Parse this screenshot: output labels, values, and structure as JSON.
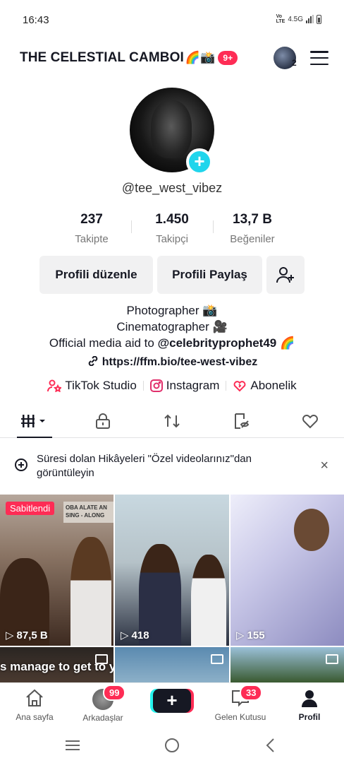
{
  "status": {
    "time": "16:43",
    "network": "4.5G",
    "volte": "Vo\nLTE"
  },
  "header": {
    "title": "THE CELESTIAL CAMBOI",
    "title_emoji": "🌈📸",
    "notif_badge": "9+",
    "account_count": "2"
  },
  "profile": {
    "username": "@tee_west_vibez"
  },
  "stats": [
    {
      "value": "237",
      "label": "Takipte"
    },
    {
      "value": "1.450",
      "label": "Takipçi"
    },
    {
      "value": "13,7 B",
      "label": "Beğeniler"
    }
  ],
  "buttons": {
    "edit": "Profili düzenle",
    "share": "Profili Paylaş"
  },
  "bio": {
    "line1": "Photographer 📸",
    "line2": "Cinematographer 🎥",
    "line3_prefix": "Official media aid to ",
    "line3_mention": "@celebrityprophet49",
    "line3_suffix": " 🌈",
    "link": "https://ffm.bio/tee-west-vibez"
  },
  "services": {
    "studio": "TikTok Studio",
    "instagram": "Instagram",
    "subscription": "Abonelik"
  },
  "notice": {
    "text": "Süresi dolan Hikâyeleri \"Özel videolarınız\"dan görüntüleyin",
    "close": "×"
  },
  "grid": {
    "pinned_label": "Sabitlendi",
    "overlay_text": "OBA ALATE AN\nSING - ALONG",
    "videos": [
      {
        "views": "87,5 B"
      },
      {
        "views": "418"
      },
      {
        "views": "155"
      }
    ],
    "row2_caption": "s manage to get to y"
  },
  "nav": {
    "home": "Ana sayfa",
    "friends": "Arkadaşlar",
    "friends_badge": "99",
    "inbox": "Gelen Kutusu",
    "inbox_badge": "33",
    "profile": "Profil",
    "plus": "+"
  },
  "colors": {
    "accent": "#fe2c55",
    "cyan": "#25f4ee",
    "text": "#161823"
  }
}
